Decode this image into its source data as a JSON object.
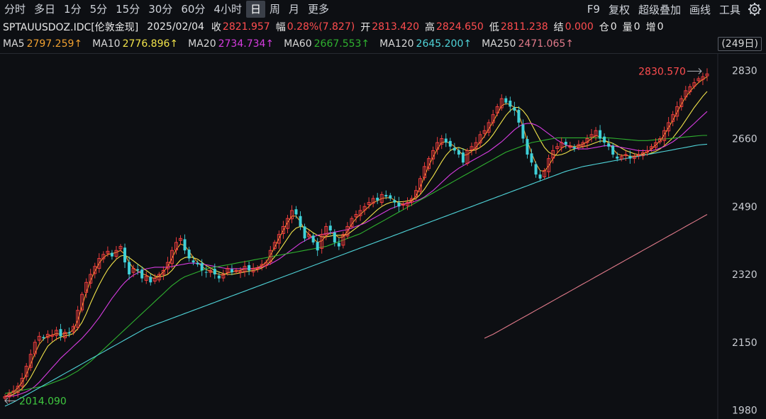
{
  "toolbar": {
    "timeframes": [
      "分时",
      "多日",
      "1分",
      "5分",
      "15分",
      "30分",
      "60分",
      "4小时",
      "日",
      "周",
      "月",
      "更多"
    ],
    "active": "日",
    "right_items": [
      "F9",
      "复权",
      "超级叠加",
      "画线",
      "工具"
    ],
    "settings_icon": "gear-icon"
  },
  "quote": {
    "symbol": "SPTAUUSDOZ.IDC[伦敦金现]",
    "date": "2025/02/04",
    "close_label": "收",
    "close": "2821.957",
    "change_label": "幅",
    "change": "0.28%(7.827)",
    "open_label": "开",
    "open": "2813.420",
    "high_label": "高",
    "high": "2824.650",
    "low_label": "低",
    "low": "2811.238",
    "settle_label": "结",
    "settle": "0.000",
    "oi_label": "仓",
    "oi": "0",
    "vol_label": "量",
    "vol": "0",
    "inc_label": "增",
    "inc": "0"
  },
  "ma_legend": [
    {
      "name": "MA5",
      "value": "2797.259↑",
      "color": "#f0a030"
    },
    {
      "name": "MA10",
      "value": "2776.896↑",
      "color": "#f2e34a"
    },
    {
      "name": "MA20",
      "value": "2734.734↑",
      "color": "#d63ce0"
    },
    {
      "name": "MA60",
      "value": "2667.553↑",
      "color": "#2fb12f"
    },
    {
      "name": "MA120",
      "value": "2645.200↑",
      "color": "#4fd3d8"
    },
    {
      "name": "MA250",
      "value": "2471.065↑",
      "color": "#e07a8a"
    }
  ],
  "period_button": "(249日)",
  "chart_data": {
    "type": "line",
    "y_ticks": [
      1980,
      2150,
      2320,
      2490,
      2660,
      2830
    ],
    "y_tick_labels": [
      "1980",
      "2150",
      "2320",
      "2490",
      "2660",
      "2830"
    ],
    "ylim": [
      1965,
      2865
    ],
    "high_annotation": "2830.570",
    "low_annotation": "2014.090",
    "up_color": "#ff4040",
    "down_color": "#3fd0d8",
    "price_series": [
      2014,
      2022,
      2028,
      2040,
      2060,
      2090,
      2120,
      2150,
      2165,
      2160,
      2170,
      2168,
      2180,
      2165,
      2175,
      2172,
      2190,
      2230,
      2270,
      2300,
      2320,
      2340,
      2360,
      2370,
      2378,
      2365,
      2380,
      2390,
      2350,
      2320,
      2335,
      2330,
      2310,
      2315,
      2300,
      2310,
      2320,
      2330,
      2350,
      2380,
      2400,
      2410,
      2380,
      2360,
      2350,
      2345,
      2330,
      2325,
      2330,
      2320,
      2310,
      2320,
      2335,
      2325,
      2330,
      2328,
      2340,
      2330,
      2335,
      2335,
      2345,
      2350,
      2380,
      2400,
      2420,
      2440,
      2460,
      2480,
      2470,
      2440,
      2410,
      2420,
      2400,
      2380,
      2420,
      2440,
      2430,
      2400,
      2390,
      2420,
      2440,
      2460,
      2470,
      2480,
      2490,
      2500,
      2510,
      2505,
      2520,
      2515,
      2510,
      2500,
      2490,
      2495,
      2500,
      2510,
      2530,
      2560,
      2590,
      2610,
      2630,
      2650,
      2660,
      2650,
      2640,
      2630,
      2620,
      2600,
      2630,
      2640,
      2650,
      2670,
      2680,
      2700,
      2720,
      2740,
      2760,
      2750,
      2740,
      2730,
      2700,
      2660,
      2620,
      2600,
      2570,
      2560,
      2580,
      2610,
      2630,
      2640,
      2650,
      2645,
      2640,
      2635,
      2645,
      2650,
      2660,
      2670,
      2680,
      2660,
      2650,
      2640,
      2620,
      2610,
      2615,
      2620,
      2610,
      2615,
      2620,
      2625,
      2630,
      2640,
      2650,
      2660,
      2680,
      2700,
      2720,
      2740,
      2760,
      2780,
      2790,
      2800,
      2810,
      2815,
      2822
    ],
    "ma_series": [
      {
        "name": "MA5",
        "color": "#f0a030",
        "values": [
          2014,
          2020,
          2026,
          2036,
          2050,
          2070,
          2095,
          2122,
          2145,
          2158,
          2165,
          2168,
          2172,
          2170,
          2172,
          2174,
          2182,
          2205,
          2240,
          2275,
          2305,
          2328,
          2348,
          2362,
          2370,
          2372,
          2375,
          2380,
          2370,
          2350,
          2335,
          2328,
          2322,
          2318,
          2312,
          2310,
          2316,
          2326,
          2340,
          2360,
          2382,
          2396,
          2392,
          2378,
          2362,
          2350,
          2340,
          2332,
          2328,
          2324,
          2320,
          2318,
          2324,
          2326,
          2328,
          2330,
          2334,
          2334,
          2335,
          2337,
          2342,
          2350,
          2368,
          2388,
          2410,
          2430,
          2450,
          2466,
          2466,
          2452,
          2432,
          2420,
          2410,
          2400,
          2404,
          2416,
          2424,
          2420,
          2412,
          2414,
          2428,
          2446,
          2460,
          2470,
          2480,
          2490,
          2500,
          2504,
          2510,
          2512,
          2512,
          2506,
          2498,
          2496,
          2498,
          2504,
          2516,
          2538,
          2566,
          2592,
          2614,
          2634,
          2650,
          2652,
          2648,
          2640,
          2630,
          2618,
          2620,
          2628,
          2638,
          2652,
          2666,
          2684,
          2702,
          2722,
          2742,
          2748,
          2745,
          2738,
          2720,
          2690,
          2654,
          2624,
          2598,
          2580,
          2578,
          2592,
          2610,
          2624,
          2636,
          2642,
          2642,
          2640,
          2642,
          2646,
          2652,
          2660,
          2668,
          2664,
          2658,
          2648,
          2634,
          2622,
          2618,
          2618,
          2616,
          2616,
          2618,
          2622,
          2626,
          2634,
          2644,
          2654,
          2670,
          2688,
          2706,
          2726,
          2746,
          2764,
          2778,
          2790,
          2800,
          2808,
          2815
        ]
      },
      {
        "name": "MA10",
        "color": "#f2e34a",
        "values": [
          2014,
          2016,
          2020,
          2026,
          2034,
          2046,
          2062,
          2082,
          2102,
          2122,
          2140,
          2150,
          2158,
          2163,
          2166,
          2168,
          2172,
          2184,
          2200,
          2222,
          2248,
          2272,
          2294,
          2314,
          2332,
          2346,
          2358,
          2366,
          2368,
          2362,
          2354,
          2346,
          2338,
          2330,
          2322,
          2316,
          2314,
          2316,
          2320,
          2330,
          2344,
          2356,
          2362,
          2364,
          2362,
          2358,
          2350,
          2342,
          2336,
          2330,
          2326,
          2322,
          2320,
          2320,
          2322,
          2324,
          2326,
          2328,
          2330,
          2332,
          2336,
          2342,
          2352,
          2364,
          2378,
          2394,
          2410,
          2426,
          2436,
          2440,
          2438,
          2432,
          2424,
          2418,
          2414,
          2414,
          2416,
          2418,
          2418,
          2418,
          2420,
          2428,
          2436,
          2444,
          2452,
          2462,
          2472,
          2482,
          2490,
          2496,
          2500,
          2502,
          2502,
          2502,
          2504,
          2506,
          2510,
          2520,
          2534,
          2550,
          2566,
          2584,
          2602,
          2618,
          2630,
          2636,
          2638,
          2634,
          2630,
          2630,
          2632,
          2638,
          2646,
          2656,
          2670,
          2686,
          2702,
          2718,
          2730,
          2738,
          2738,
          2730,
          2716,
          2696,
          2676,
          2656,
          2638,
          2626,
          2620,
          2618,
          2620,
          2624,
          2630,
          2634,
          2638,
          2640,
          2642,
          2646,
          2650,
          2654,
          2654,
          2652,
          2648,
          2642,
          2636,
          2630,
          2626,
          2622,
          2620,
          2620,
          2620,
          2624,
          2628,
          2634,
          2642,
          2652,
          2662,
          2676,
          2690,
          2706,
          2722,
          2738,
          2752,
          2766,
          2778
        ]
      },
      {
        "name": "MA20",
        "color": "#d63ce0",
        "values": [
          2014,
          2015,
          2016,
          2018,
          2022,
          2026,
          2032,
          2040,
          2050,
          2062,
          2074,
          2086,
          2098,
          2110,
          2120,
          2130,
          2140,
          2150,
          2160,
          2172,
          2184,
          2198,
          2212,
          2228,
          2244,
          2260,
          2274,
          2288,
          2300,
          2310,
          2318,
          2324,
          2330,
          2334,
          2336,
          2338,
          2338,
          2338,
          2338,
          2340,
          2342,
          2344,
          2346,
          2348,
          2348,
          2348,
          2346,
          2344,
          2342,
          2340,
          2338,
          2336,
          2334,
          2334,
          2334,
          2334,
          2334,
          2334,
          2334,
          2336,
          2338,
          2342,
          2346,
          2352,
          2358,
          2366,
          2374,
          2382,
          2390,
          2398,
          2404,
          2410,
          2414,
          2418,
          2420,
          2422,
          2424,
          2426,
          2428,
          2430,
          2432,
          2436,
          2440,
          2444,
          2448,
          2454,
          2460,
          2466,
          2472,
          2478,
          2484,
          2488,
          2492,
          2496,
          2498,
          2500,
          2504,
          2508,
          2514,
          2522,
          2530,
          2540,
          2550,
          2560,
          2570,
          2578,
          2586,
          2592,
          2598,
          2604,
          2610,
          2616,
          2622,
          2628,
          2636,
          2644,
          2652,
          2662,
          2672,
          2682,
          2690,
          2696,
          2698,
          2698,
          2694,
          2688,
          2680,
          2672,
          2664,
          2656,
          2650,
          2644,
          2640,
          2636,
          2634,
          2634,
          2634,
          2636,
          2638,
          2640,
          2642,
          2642,
          2642,
          2640,
          2638,
          2636,
          2634,
          2632,
          2630,
          2630,
          2630,
          2630,
          2632,
          2636,
          2640,
          2646,
          2652,
          2660,
          2668,
          2678,
          2688,
          2698,
          2708,
          2718,
          2728
        ]
      },
      {
        "name": "MA60",
        "color": "#2fb12f",
        "values": [
          2022,
          2024,
          2026,
          2028,
          2030,
          2032,
          2034,
          2036,
          2038,
          2040,
          2044,
          2048,
          2052,
          2056,
          2060,
          2066,
          2072,
          2078,
          2086,
          2094,
          2102,
          2112,
          2122,
          2132,
          2142,
          2152,
          2162,
          2172,
          2182,
          2192,
          2202,
          2212,
          2222,
          2232,
          2242,
          2252,
          2262,
          2272,
          2282,
          2292,
          2300,
          2308,
          2314,
          2318,
          2322,
          2326,
          2330,
          2334,
          2336,
          2338,
          2340,
          2342,
          2344,
          2346,
          2348,
          2350,
          2352,
          2354,
          2356,
          2358,
          2360,
          2362,
          2364,
          2366,
          2368,
          2370,
          2372,
          2374,
          2376,
          2378,
          2380,
          2382,
          2384,
          2386,
          2388,
          2390,
          2394,
          2398,
          2402,
          2406,
          2410,
          2414,
          2418,
          2422,
          2428,
          2434,
          2440,
          2446,
          2452,
          2458,
          2464,
          2470,
          2476,
          2482,
          2488,
          2494,
          2500,
          2506,
          2512,
          2518,
          2524,
          2530,
          2536,
          2542,
          2548,
          2554,
          2560,
          2566,
          2572,
          2578,
          2584,
          2590,
          2596,
          2602,
          2608,
          2614,
          2620,
          2626,
          2630,
          2634,
          2638,
          2642,
          2646,
          2650,
          2652,
          2654,
          2656,
          2658,
          2660,
          2662,
          2662,
          2662,
          2662,
          2662,
          2662,
          2662,
          2662,
          2662,
          2662,
          2662,
          2662,
          2662,
          2661,
          2660,
          2659,
          2658,
          2657,
          2656,
          2655,
          2655,
          2655,
          2656,
          2657,
          2658,
          2659,
          2660,
          2661,
          2662,
          2663,
          2664,
          2665,
          2666,
          2667,
          2668,
          2668
        ]
      },
      {
        "name": "MA120",
        "color": "#4fd3d8",
        "values": [
          1990,
          1995,
          2000,
          2006,
          2012,
          2018,
          2024,
          2030,
          2036,
          2042,
          2048,
          2054,
          2060,
          2066,
          2072,
          2078,
          2084,
          2090,
          2096,
          2102,
          2108,
          2114,
          2120,
          2126,
          2132,
          2138,
          2144,
          2150,
          2156,
          2162,
          2168,
          2174,
          2180,
          2186,
          2190,
          2194,
          2198,
          2202,
          2206,
          2210,
          2214,
          2218,
          2222,
          2226,
          2230,
          2234,
          2238,
          2242,
          2246,
          2250,
          2254,
          2258,
          2262,
          2266,
          2270,
          2274,
          2278,
          2282,
          2286,
          2290,
          2294,
          2298,
          2302,
          2306,
          2310,
          2314,
          2318,
          2322,
          2326,
          2330,
          2334,
          2338,
          2342,
          2346,
          2350,
          2354,
          2358,
          2362,
          2366,
          2370,
          2374,
          2378,
          2382,
          2386,
          2390,
          2394,
          2398,
          2402,
          2406,
          2410,
          2414,
          2418,
          2422,
          2426,
          2430,
          2434,
          2438,
          2442,
          2446,
          2450,
          2454,
          2458,
          2462,
          2466,
          2470,
          2474,
          2478,
          2482,
          2486,
          2490,
          2494,
          2498,
          2502,
          2506,
          2510,
          2514,
          2518,
          2522,
          2526,
          2530,
          2534,
          2538,
          2542,
          2546,
          2550,
          2554,
          2558,
          2562,
          2566,
          2570,
          2574,
          2578,
          2581,
          2584,
          2587,
          2590,
          2592,
          2594,
          2596,
          2598,
          2600,
          2602,
          2604,
          2606,
          2608,
          2610,
          2612,
          2614,
          2616,
          2618,
          2620,
          2622,
          2624,
          2626,
          2628,
          2630,
          2632,
          2634,
          2636,
          2638,
          2640,
          2642,
          2644,
          2645,
          2646
        ]
      },
      {
        "name": "MA250",
        "color": "#e07a8a",
        "values": [
          2160,
          2165,
          2170,
          2176,
          2182,
          2188,
          2194,
          2200,
          2206,
          2212,
          2218,
          2224,
          2230,
          2236,
          2242,
          2248,
          2254,
          2260,
          2266,
          2272,
          2278,
          2284,
          2290,
          2296,
          2302,
          2308,
          2314,
          2320,
          2326,
          2332,
          2338,
          2344,
          2350,
          2356,
          2362,
          2368,
          2374,
          2380,
          2386,
          2392,
          2398,
          2404,
          2410,
          2416,
          2422,
          2428,
          2434,
          2440,
          2446,
          2452,
          2458,
          2464,
          2470
        ]
      }
    ]
  }
}
